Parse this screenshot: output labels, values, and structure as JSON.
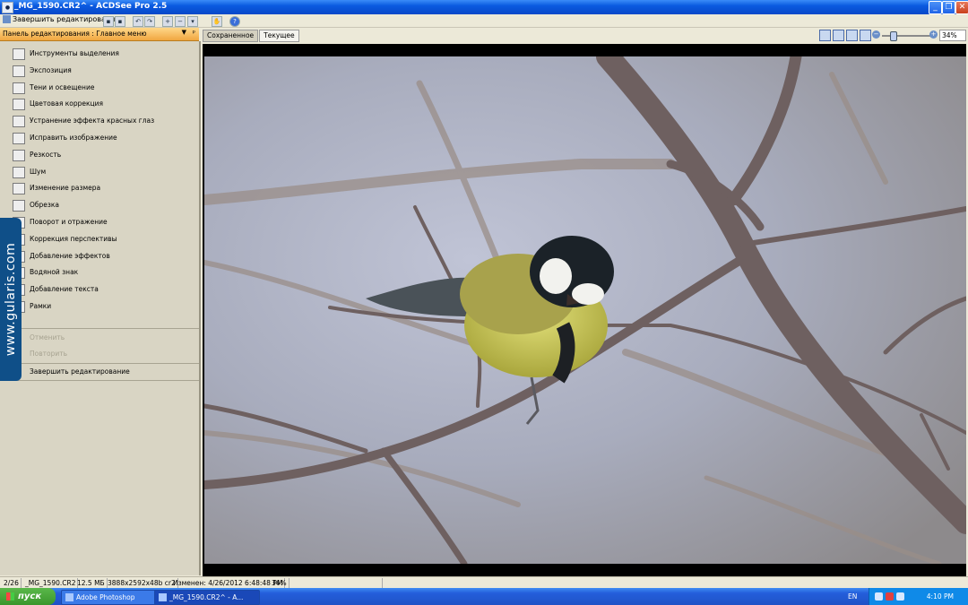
{
  "window": {
    "title": "_MG_1590.CR2^ - ACDSee Pro 2.5",
    "controls": [
      "minimize",
      "maximize",
      "close"
    ]
  },
  "toolbar": {
    "done_label": "Завершить редактирование"
  },
  "panel": {
    "header": "Панель редактирования : Главное меню",
    "items": [
      {
        "label": "Инструменты выделения",
        "icon": "selection-icon"
      },
      {
        "label": "Экспозиция",
        "icon": "exposure-icon"
      },
      {
        "label": "Тени и освещение",
        "icon": "shadows-icon"
      },
      {
        "label": "Цветовая коррекция",
        "icon": "color-icon"
      },
      {
        "label": "Устранение эффекта красных глаз",
        "icon": "red-eye-icon"
      },
      {
        "label": "Исправить изображение",
        "icon": "repair-icon"
      },
      {
        "label": "Резкость",
        "icon": "sharpen-icon"
      },
      {
        "label": "Шум",
        "icon": "noise-icon"
      },
      {
        "label": "Изменение размера",
        "icon": "resize-icon"
      },
      {
        "label": "Обрезка",
        "icon": "crop-icon"
      },
      {
        "label": "Поворот и отражение",
        "icon": "rotate-icon"
      },
      {
        "label": "Коррекция перспективы",
        "icon": "perspective-icon"
      },
      {
        "label": "Добавление эффектов",
        "icon": "effects-icon"
      },
      {
        "label": "Водяной знак",
        "icon": "watermark-icon"
      },
      {
        "label": "Добавление текста",
        "icon": "text-icon"
      },
      {
        "label": "Рамки",
        "icon": "frames-icon"
      }
    ],
    "undo": "Отменить",
    "redo": "Повторить",
    "finish": "Завершить редактирование"
  },
  "watermark": "www.gularis.com",
  "tabs": {
    "saved": "Сохраненное",
    "current": "Текущее"
  },
  "zoom": "34%",
  "statusbar": {
    "index": "2/26",
    "filename": "_MG_1590.CR2",
    "size": "12.5 МБ",
    "dimensions": "3888x2592x48b cr2",
    "modified": "Изменен: 4/26/2012 6:48:48 PM",
    "zoom": "34%"
  },
  "taskbar": {
    "start": "пуск",
    "tasks": [
      "Adobe Photoshop",
      "_MG_1590.CR2^ - A..."
    ],
    "lang": "EN",
    "clock": "4:10 PM"
  }
}
